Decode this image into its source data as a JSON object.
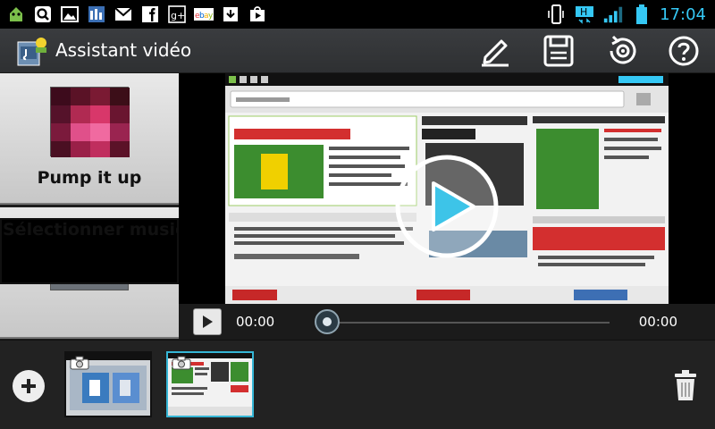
{
  "status_bar": {
    "time": "17:04",
    "network": "H",
    "icons": [
      "android-icon",
      "search-icon",
      "gallery-icon",
      "calendar-icon",
      "gmail-icon",
      "facebook-icon",
      "googleplus-icon",
      "ebay-icon",
      "download-icon",
      "play-store-icon"
    ]
  },
  "action_bar": {
    "title": "Assistant vidéo",
    "buttons": [
      "edit-icon",
      "save-icon",
      "settings-icon",
      "help-icon"
    ]
  },
  "music": {
    "items": [
      {
        "label": "Pump it up"
      },
      {
        "label": "Sélectionner musique"
      }
    ]
  },
  "player": {
    "time_start": "00:00",
    "time_end": "00:00",
    "progress": 0
  },
  "clips": {
    "count": 2,
    "selected_index": 1
  },
  "colors": {
    "accent": "#35c8f5",
    "selection": "#35b6d6",
    "play_overlay": "#3dc4e8"
  }
}
